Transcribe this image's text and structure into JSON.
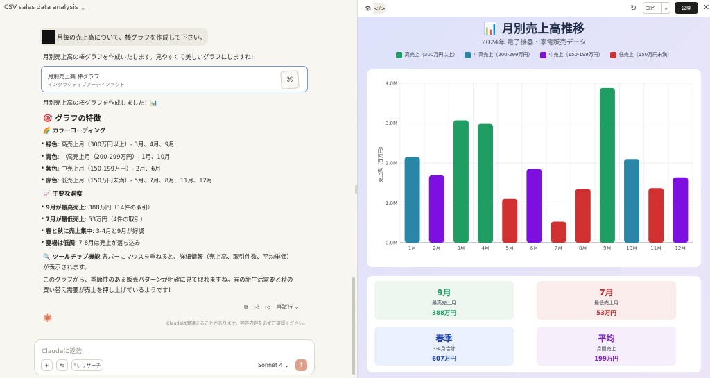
{
  "app": {
    "title": "CSV sales data analysis"
  },
  "chat": {
    "user_message": "月毎の売上高について、棒グラフを作成して下さい。",
    "reply_intro": "月別売上高の棒グラフを作成いたします。見やすくて美しいグラフにしますね！",
    "artifact": {
      "title": "月別売上高 棒グラフ",
      "subtitle": "インタラクティブアーティファクト"
    },
    "done_text": "月別売上高の棒グラフを作成しました！📊",
    "features_heading": "🎯 グラフの特徴",
    "color_heading": "🌈 カラーコーディング",
    "color_items": [
      {
        "label": "緑色",
        "text": ": 高売上月（300万円以上）- 3月、4月、9月"
      },
      {
        "label": "青色",
        "text": ": 中高売上月（200-299万円）- 1月、10月"
      },
      {
        "label": "紫色",
        "text": ": 中売上月（150-199万円）- 2月、6月"
      },
      {
        "label": "赤色",
        "text": ": 低売上月（150万円未満）- 5月、7月、8月、11月、12月"
      }
    ],
    "insight_heading": "📈 主要な洞察",
    "insights": [
      {
        "label": "9月が最高売上",
        "text": ": 388万円（14件の取引）"
      },
      {
        "label": "7月が最低売上",
        "text": ": 53万円（4件の取引）"
      },
      {
        "label": "春と秋に売上集中",
        "text": ": 3-4月と9月が好調"
      },
      {
        "label": "夏場は低調",
        "text": ": 7-8月は売上が落ち込み"
      }
    ],
    "tooltip_label": "🔍 ツールチップ機能",
    "tooltip_text": "各バーにマウスを重ねると、詳細情報（売上高、取引件数、平均単価）",
    "tooltip_text2": "が表示されます。",
    "closing_1": "このグラフから、季節性のある販売パターンが明確に見て取れますね。春の新生活需要と秋の",
    "closing_2": "買い替え需要が売上を押し上げているようです！",
    "retry_label": "再試行",
    "disclaimer": "Claudeは間違えることがあります。回答内容を必ずご確認ください。",
    "input_placeholder": "Claudeに返信...",
    "research_label": "リサーチ",
    "model_label": "Sonnet 4"
  },
  "artifact_toolbar": {
    "copy_label": "コピー",
    "publish_label": "公開"
  },
  "colors": {
    "high": "#1e9e63",
    "midhigh": "#2a86a7",
    "mid": "#7d0fe0",
    "low": "#d0302f"
  },
  "chart_data": {
    "type": "bar",
    "title": "📊 月別売上高推移",
    "subtitle": "2024年 電子機器・家電販売データ",
    "ylabel": "売上高（百万円）",
    "xlabel": "",
    "categories": [
      "1月",
      "2月",
      "3月",
      "4月",
      "5月",
      "6月",
      "7月",
      "8月",
      "9月",
      "10月",
      "11月",
      "12月"
    ],
    "values": [
      2.15,
      1.69,
      3.07,
      2.98,
      1.1,
      1.85,
      0.53,
      1.35,
      3.88,
      2.1,
      1.37,
      1.64
    ],
    "color_group": [
      "midhigh",
      "mid",
      "high",
      "high",
      "low",
      "mid",
      "low",
      "low",
      "high",
      "midhigh",
      "low",
      "low"
    ],
    "bar_color_override": {
      "11": "mid"
    },
    "ylim": [
      0,
      4.0
    ],
    "yticks": [
      "0.0M",
      "1.0M",
      "2.0M",
      "3.0M",
      "4.0M"
    ],
    "legend": [
      {
        "key": "high",
        "label": "高売上（300万円以上）"
      },
      {
        "key": "midhigh",
        "label": "中高売上（200-299万円）"
      },
      {
        "key": "mid",
        "label": "中売上（150-199万円）"
      },
      {
        "key": "low",
        "label": "低売上（150万円未満）"
      }
    ],
    "grid": true
  },
  "stats": [
    {
      "big": "9月",
      "small": "最高売上月",
      "val": "388万円",
      "bg": "#edf7ef",
      "fg": "#1e9e63"
    },
    {
      "big": "7月",
      "small": "最低売上月",
      "val": "53万円",
      "bg": "#fbecec",
      "fg": "#c62828"
    },
    {
      "big": "春季",
      "small": "3-4月合計",
      "val": "607万円",
      "bg": "#eaf0fd",
      "fg": "#1e40af"
    },
    {
      "big": "平均",
      "small": "月間売上",
      "val": "199万円",
      "bg": "#f6eefb",
      "fg": "#7e22ce"
    }
  ]
}
